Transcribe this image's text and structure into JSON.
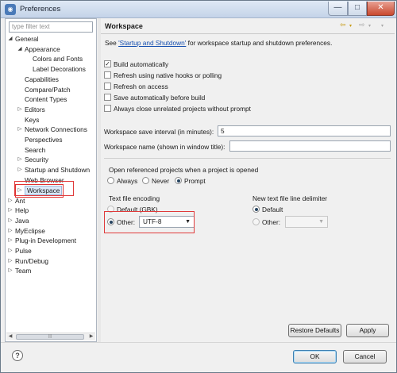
{
  "window": {
    "title": "Preferences",
    "controls": {
      "minimize": "—",
      "maximize": "□",
      "close": "✕"
    }
  },
  "sidebar": {
    "filter_placeholder": "type filter text",
    "tree": [
      {
        "label": "General",
        "twisty": "◢"
      },
      {
        "label": "Appearance",
        "twisty": "◢"
      },
      {
        "label": "Colors and Fonts",
        "twisty": ""
      },
      {
        "label": "Label Decorations",
        "twisty": ""
      },
      {
        "label": "Capabilities",
        "twisty": ""
      },
      {
        "label": "Compare/Patch",
        "twisty": ""
      },
      {
        "label": "Content Types",
        "twisty": ""
      },
      {
        "label": "Editors",
        "twisty": "▷"
      },
      {
        "label": "Keys",
        "twisty": ""
      },
      {
        "label": "Network Connections",
        "twisty": "▷"
      },
      {
        "label": "Perspectives",
        "twisty": ""
      },
      {
        "label": "Search",
        "twisty": ""
      },
      {
        "label": "Security",
        "twisty": "▷"
      },
      {
        "label": "Startup and Shutdown",
        "twisty": "▷"
      },
      {
        "label": "Web Browser",
        "twisty": ""
      },
      {
        "label": "Workspace",
        "twisty": "▷"
      },
      {
        "label": "Ant",
        "twisty": "▷"
      },
      {
        "label": "Help",
        "twisty": "▷"
      },
      {
        "label": "Java",
        "twisty": "▷"
      },
      {
        "label": "MyEclipse",
        "twisty": "▷"
      },
      {
        "label": "Plug-in Development",
        "twisty": "▷"
      },
      {
        "label": "Pulse",
        "twisty": "▷"
      },
      {
        "label": "Run/Debug",
        "twisty": "▷"
      },
      {
        "label": "Team",
        "twisty": "▷"
      }
    ],
    "scroll_left": "◀",
    "scroll_right": "▶",
    "scroll_grip": "|||"
  },
  "page": {
    "title": "Workspace",
    "nav_back": "⇦",
    "nav_forward": "⇨",
    "nav_menu": "▾",
    "see_prefix": "See ",
    "see_link": "'Startup and Shutdown'",
    "see_suffix": " for workspace startup and shutdown preferences.",
    "checkboxes": [
      {
        "label": "Build automatically",
        "checked": true
      },
      {
        "label": "Refresh using native hooks or polling",
        "checked": false
      },
      {
        "label": "Refresh on access",
        "checked": false
      },
      {
        "label": "Save automatically before build",
        "checked": false
      },
      {
        "label": "Always close unrelated projects without prompt",
        "checked": false
      }
    ],
    "save_interval_label": "Workspace save interval (in minutes):",
    "save_interval_value": "5",
    "workspace_name_label": "Workspace name (shown in window title):",
    "workspace_name_value": "",
    "open_projects": {
      "label": "Open referenced projects when a project is opened",
      "options": [
        "Always",
        "Never",
        "Prompt"
      ],
      "selected": "Prompt"
    },
    "encoding": {
      "label": "Text file encoding",
      "default_label": "Default (GBK)",
      "other_label": "Other:",
      "selected": "Other",
      "other_value": "UTF-8"
    },
    "line_delimiter": {
      "label": "New text file line delimiter",
      "default_label": "Default",
      "other_label": "Other:",
      "selected": "Default",
      "other_value": ""
    },
    "restore_defaults": "Restore Defaults",
    "apply": "Apply"
  },
  "footer": {
    "help_icon": "?",
    "ok": "OK",
    "cancel": "Cancel"
  },
  "highlight_color": "#e03a3a",
  "selection_color": "#dce8f7"
}
